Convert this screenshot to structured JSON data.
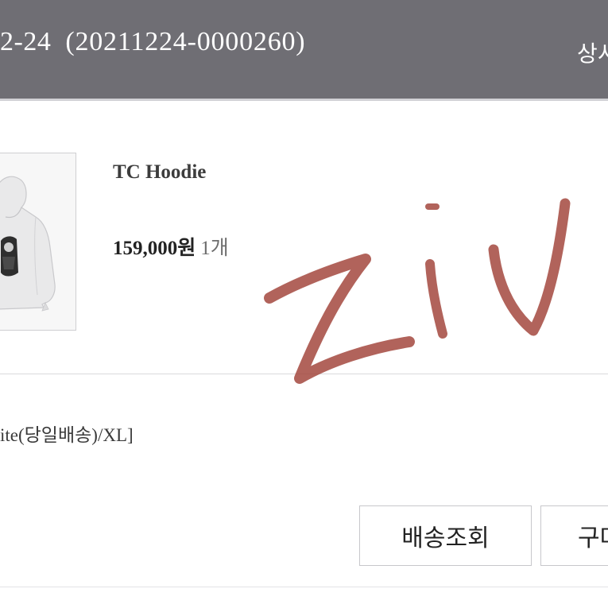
{
  "header": {
    "order_date_partial": "2-24",
    "order_number": "(20211224-0000260)",
    "link_partial": "상시"
  },
  "product": {
    "image_icon": "hoodie-photo",
    "name": "TC Hoodie",
    "price": "159,000원",
    "quantity": "1개",
    "option": "ite(당일배송)/XL]"
  },
  "actions": {
    "track_delivery_label": "배송조회",
    "second_button_partial": "구마"
  },
  "overlay": {
    "signature_text": "ZIV",
    "signature_color": "#a3483e"
  },
  "colors": {
    "header_bg": "#6f6e74",
    "header_text": "#ffffff"
  }
}
